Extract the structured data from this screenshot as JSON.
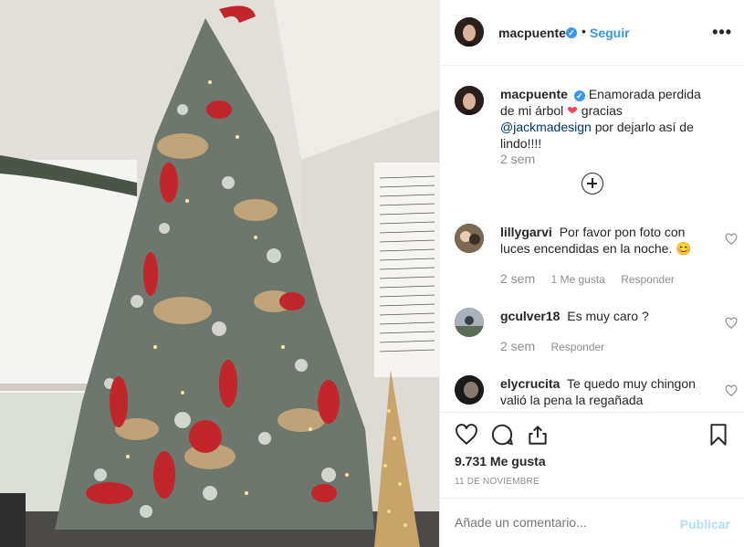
{
  "post": {
    "photo_alt": "decorated christmas tree",
    "author": "macpuente",
    "follow_label": "Seguir",
    "separator": "•",
    "more_label": "•••"
  },
  "caption": {
    "username": "macpuente",
    "text_before": "Enamorada perdida de mi árbol",
    "heart": "❤",
    "text_middle": " gracias ",
    "mention": "@jackmadesign",
    "text_after": " por dejarlo así de lindo!!!!",
    "time": "2 sem"
  },
  "comments": [
    {
      "username": "lillygarvi",
      "text": "Por favor pon foto con luces encendidas en la noche. ",
      "emoji": "😊",
      "time": "2 sem",
      "likes": "1 Me gusta",
      "reply": "Responder"
    },
    {
      "username": "gculver18",
      "text": "Es muy caro ?",
      "time": "2 sem",
      "reply": "Responder"
    },
    {
      "username": "elycrucita",
      "text": "Te quedo muy chingon valió la pena la regañada"
    }
  ],
  "actions": {
    "likes_count": "9.731 Me gusta",
    "date": "11 DE NOVIEMBRE"
  },
  "add_comment": {
    "placeholder": "Añade un comentario...",
    "publish_label": "Publicar"
  },
  "colors": {
    "link_blue": "#3897f0",
    "publish_disabled": "#b2dffc",
    "heart_red": "#ed4956",
    "muted": "#8e8e8e"
  }
}
